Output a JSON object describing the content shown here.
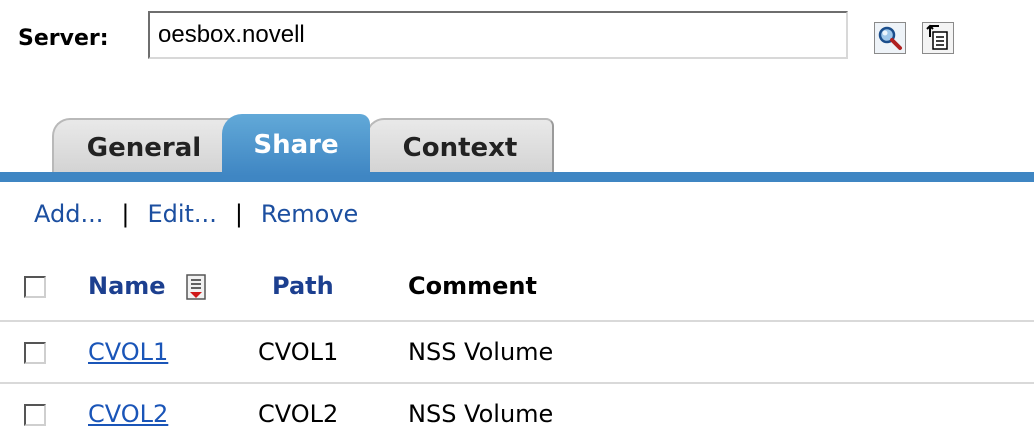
{
  "server": {
    "label": "Server:",
    "value": "oesbox.novell",
    "search_icon": "magnifier-icon",
    "browse_icon": "object-browser-icon"
  },
  "tabs": [
    {
      "label": "General",
      "active": false
    },
    {
      "label": "Share",
      "active": true
    },
    {
      "label": "Context",
      "active": false
    }
  ],
  "actions": {
    "add": "Add...",
    "separator": "|",
    "edit": "Edit...",
    "remove": "Remove"
  },
  "table": {
    "columns": {
      "name": "Name",
      "path": "Path",
      "comment": "Comment"
    },
    "sort_icon": "sort-descending-icon",
    "rows": [
      {
        "name": "CVOL1",
        "path": "CVOL1",
        "comment": "NSS Volume"
      },
      {
        "name": "CVOL2",
        "path": "CVOL2",
        "comment": "NSS Volume"
      }
    ]
  },
  "colors": {
    "accent": "#3f86c3",
    "link": "#1a55b8",
    "tab_inactive": "#d9d9d9"
  }
}
